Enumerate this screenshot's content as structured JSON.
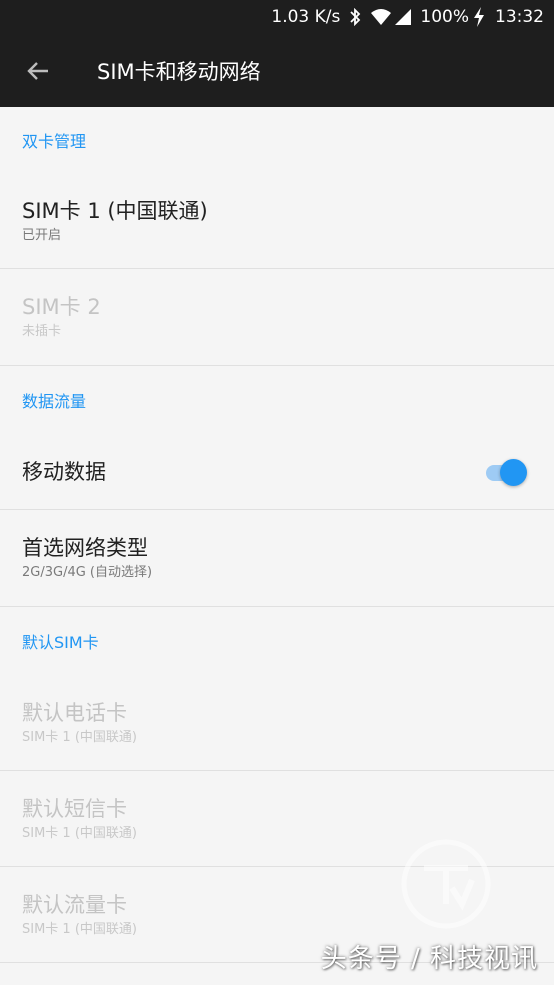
{
  "status_bar": {
    "speed": "1.03 K/s",
    "battery": "100%",
    "time": "13:32",
    "icons": [
      "bluetooth-icon",
      "wifi-icon",
      "signal-icon",
      "charging-icon"
    ]
  },
  "app_bar": {
    "title": "SIM卡和移动网络",
    "back_icon": "arrow-left-icon"
  },
  "colors": {
    "accent": "#2196f3",
    "header_bg": "#1e1e1e",
    "page_bg": "#f5f5f5"
  },
  "sections": {
    "dual_sim": {
      "header": "双卡管理",
      "sim1": {
        "title": "SIM卡 1  (中国联通)",
        "subtitle": "已开启"
      },
      "sim2": {
        "title": "SIM卡 2",
        "subtitle": "未插卡"
      }
    },
    "data": {
      "header": "数据流量",
      "mobile_data": {
        "title": "移动数据",
        "enabled": true
      },
      "network_type": {
        "title": "首选网络类型",
        "subtitle": "2G/3G/4G (自动选择)"
      }
    },
    "default_sim": {
      "header": "默认SIM卡",
      "call": {
        "title": "默认电话卡",
        "subtitle": "SIM卡 1  (中国联通)"
      },
      "sms": {
        "title": "默认短信卡",
        "subtitle": "SIM卡 1  (中国联通)"
      },
      "data": {
        "title": "默认流量卡",
        "subtitle": "SIM卡 1  (中国联通)"
      }
    }
  },
  "watermark": "头条号 / 科技视讯"
}
